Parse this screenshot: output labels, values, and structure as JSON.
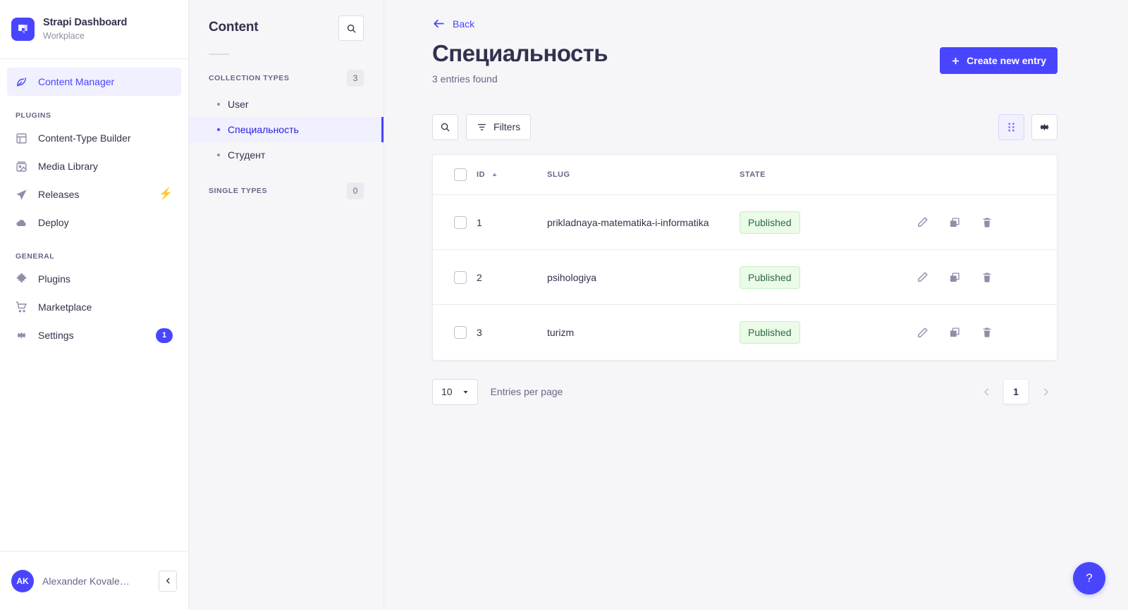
{
  "brand": {
    "title": "Strapi Dashboard",
    "subtitle": "Workplace",
    "logo_color": "#4945ff"
  },
  "sidebar": {
    "main_item": {
      "label": "Content Manager",
      "icon": "feather-edit-icon"
    },
    "sections": [
      {
        "label": "PLUGINS",
        "items": [
          {
            "label": "Content-Type Builder",
            "icon": "layout-icon",
            "badge": ""
          },
          {
            "label": "Media Library",
            "icon": "image-icon",
            "badge": ""
          },
          {
            "label": "Releases",
            "icon": "paper-plane-icon",
            "badge": "",
            "bolt": "⚡"
          },
          {
            "label": "Deploy",
            "icon": "cloud-icon",
            "badge": ""
          }
        ]
      },
      {
        "label": "GENERAL",
        "items": [
          {
            "label": "Plugins",
            "icon": "puzzle-icon",
            "badge": ""
          },
          {
            "label": "Marketplace",
            "icon": "shopping-cart-icon",
            "badge": ""
          },
          {
            "label": "Settings",
            "icon": "gear-icon",
            "badge": "1"
          }
        ]
      }
    ],
    "user": {
      "initials": "AK",
      "name": "Alexander Kovale…"
    }
  },
  "content_panel": {
    "title": "Content",
    "search_icon": "search-icon",
    "collection_types": {
      "label": "COLLECTION TYPES",
      "count": "3",
      "items": [
        {
          "label": "User",
          "active": false
        },
        {
          "label": "Специальность",
          "active": true
        },
        {
          "label": "Студент",
          "active": false
        }
      ]
    },
    "single_types": {
      "label": "SINGLE TYPES",
      "count": "0",
      "items": []
    }
  },
  "main": {
    "back_label": "Back",
    "page_title": "Специальность",
    "entries_found": "3 entries found",
    "create_button": "Create new entry",
    "toolbar": {
      "search_icon": "search-icon",
      "filters_label": "Filters",
      "grid_view_icon": "grid-dots-icon",
      "settings_icon": "gear-icon"
    },
    "table": {
      "columns": [
        "ID",
        "SLUG",
        "STATE"
      ],
      "sort_column": "ID",
      "sort_direction": "asc",
      "rows": [
        {
          "id": "1",
          "slug": "prikladnaya-matematika-i-informatika",
          "state": "Published"
        },
        {
          "id": "2",
          "slug": "psihologiya",
          "state": "Published"
        },
        {
          "id": "3",
          "slug": "turizm",
          "state": "Published"
        }
      ],
      "row_actions": [
        "edit-icon",
        "duplicate-icon",
        "delete-icon"
      ]
    },
    "pagination": {
      "page_size": "10",
      "entries_per_page_label": "Entries per page",
      "current_page": "1",
      "prev_label": "‹",
      "next_label": "›"
    },
    "help_button": "?"
  },
  "colors": {
    "accent": "#4945ff",
    "accent_dark": "#271fe0",
    "published_bg": "#eafbe7",
    "published_text": "#2f6846",
    "page_bg": "#f6f6f9",
    "text_main": "#32324d",
    "text_muted": "#666687"
  }
}
